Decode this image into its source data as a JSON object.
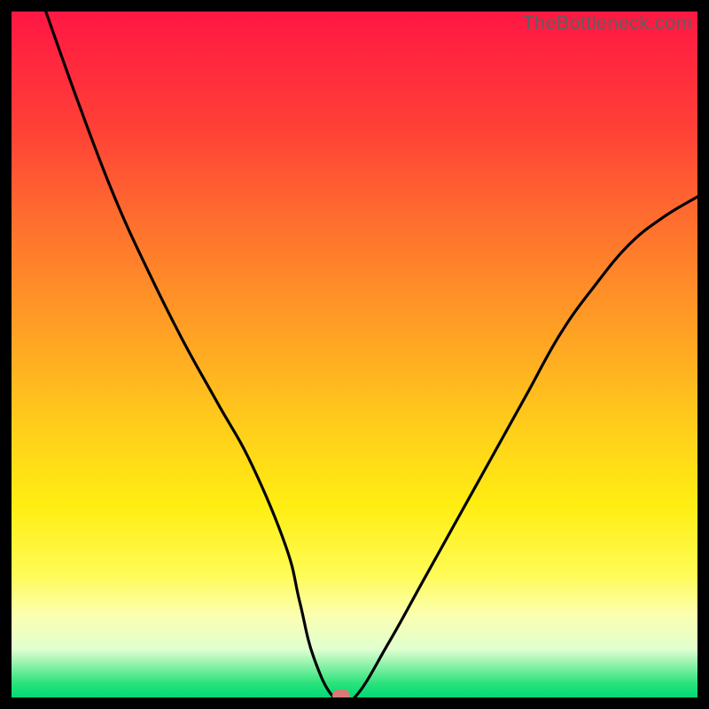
{
  "watermark": "TheBottleneck.com",
  "chart_data": {
    "type": "line",
    "title": "",
    "xlabel": "",
    "ylabel": "",
    "xlim": [
      0,
      100
    ],
    "ylim": [
      0,
      100
    ],
    "series": [
      {
        "name": "bottleneck-curve",
        "x": [
          5,
          10,
          15,
          20,
          25,
          30,
          35,
          40,
          42,
          44,
          47,
          50,
          55,
          60,
          65,
          70,
          75,
          80,
          85,
          90,
          95,
          100
        ],
        "values": [
          100,
          86,
          73,
          62,
          52,
          43,
          34,
          22,
          14,
          6,
          0,
          0,
          8,
          17,
          26,
          35,
          44,
          53,
          60,
          66,
          70,
          73
        ]
      }
    ],
    "marker": {
      "x": 48,
      "y": 0
    },
    "gradient_stops": [
      {
        "pos": 0,
        "color": "#ff1744"
      },
      {
        "pos": 50,
        "color": "#ffd21a"
      },
      {
        "pos": 88,
        "color": "#fbffb0"
      },
      {
        "pos": 100,
        "color": "#00d977"
      }
    ]
  }
}
